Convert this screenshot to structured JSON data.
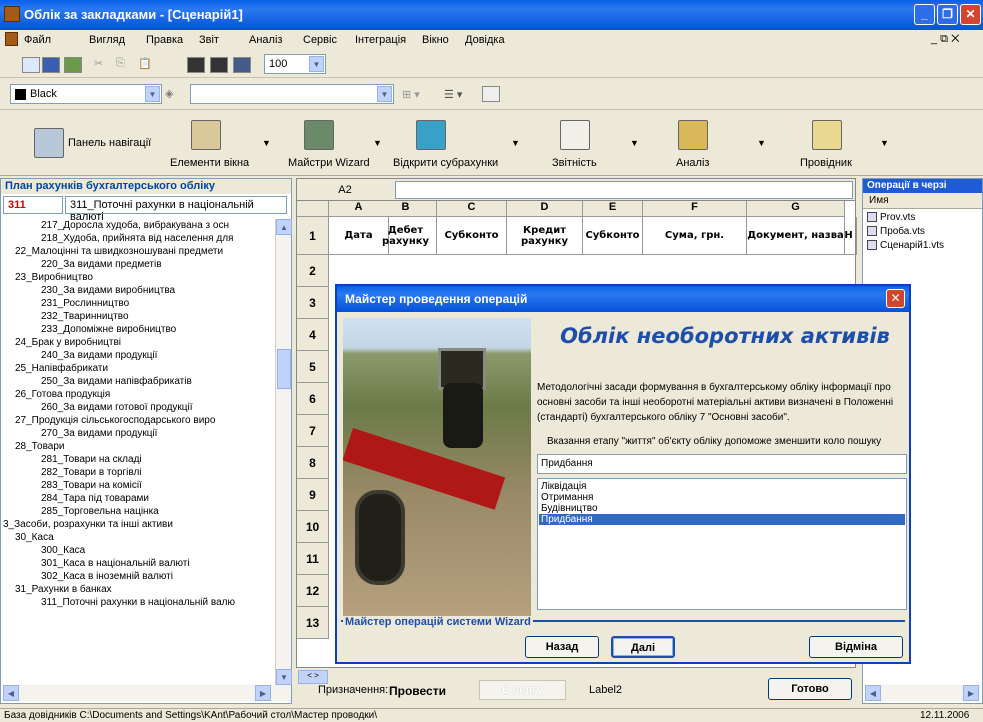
{
  "window": {
    "title": "Облік за закладками - [Сценарій1]"
  },
  "menu": [
    "Файл",
    "Вигляд",
    "Правка",
    "Звіт",
    "Аналіз",
    "Сервіс",
    "Інтеграція",
    "Вікно",
    "Довідка"
  ],
  "toolbar": {
    "zoom": "100",
    "color": "Black",
    "font_name": ""
  },
  "bigtoolbar": {
    "nav": "Панель навігації",
    "elements": "Елементи вікна",
    "masters": "Майстри Wizard",
    "subaccounts": "Відкрити субрахунки",
    "reports": "Звітність",
    "analysis": "Аналіз",
    "explorer": "Провідник"
  },
  "leftpanel": {
    "header": "План рахунків бухгалтерського обліку",
    "account_code": "311",
    "account_name": "311_Поточні рахунки в національній валюті",
    "tree": [
      "217_Доросла худоба, вибракувана з осн",
      "218_Худоба, прийнята від населення для",
      "22_Малоцінні та швидкозношувані предмети",
      "220_За видами предметів",
      "23_Виробництво",
      "230_За видами виробництва",
      "231_Рослинництво",
      "232_Тваринництво",
      "233_Допоміжне виробництво",
      "24_Брак у виробництві",
      "240_За видами продукції",
      "25_Напівфабрикати",
      "250_За видами напівфабрикатів",
      "26_Готова продукція",
      "260_За видами готової продукції",
      "27_Продукція сільськогосподарського виро",
      "270_За видами продукції",
      "28_Товари",
      "281_Товари на складі",
      "282_Товари в торгівлі",
      "283_Товари на комісії",
      "284_Тара під товарами",
      "285_Торговельна націнка",
      "3_Засоби, розрахунки та інші активи",
      "30_Каса",
      "300_Каса",
      "301_Каса в національній валюті",
      "302_Каса в іноземній валюті",
      "31_Рахунки в банках",
      "311_Поточні рахунки в національній валю"
    ]
  },
  "grid": {
    "cell_ref": "A2",
    "formula": "",
    "columns": [
      "A",
      "B",
      "C",
      "D",
      "E",
      "F",
      "G"
    ],
    "headers": [
      "Дата",
      "Дебет рахунку",
      "Субконто",
      "Кредит рахунку",
      "Субконто",
      "Сума, грн.",
      "Документ, назва",
      "Н"
    ],
    "rows": [
      "1",
      "2",
      "3",
      "4",
      "5",
      "6",
      "7",
      "8",
      "9",
      "10",
      "11",
      "12",
      "13"
    ]
  },
  "bottom": {
    "purpose_label": "Призначення:",
    "execute": "Провести",
    "queue": "В чергу",
    "label2": "Label2",
    "done": "Готово"
  },
  "rightpanel": {
    "header": "Операції в черзі",
    "col": "Имя",
    "items": [
      "Prov.vts",
      "Проба.vts",
      "Сценарій1.vts"
    ]
  },
  "dialog": {
    "title": "Майстер проведення операцій",
    "heading": "Облік необоротних активів",
    "text1": "Методологічні засади формування в бухгалтерському обліку інформації про основні засоби та інші необоротні матеріальні активи визначені в Положенні (стандарті) бухгалтерського обліку 7 \"Основні засоби\".",
    "text2": "Вказання етапу \"життя\" об'єкту обліку допоможе зменшити коло пошуку",
    "input": "Придбання",
    "options": [
      "Ліквідація",
      "Отримання",
      "Будівництво",
      "Придбання"
    ],
    "selected_index": 3,
    "group_label": "Майстер операцій системи Wizard",
    "back": "Назад",
    "next": "Далі",
    "cancel": "Відміна"
  },
  "status": {
    "path": "База довідників  C:\\Documents and Settings\\KAnt\\Рабочий стол\\Мастер проводки\\",
    "date": "12.11.2006"
  }
}
